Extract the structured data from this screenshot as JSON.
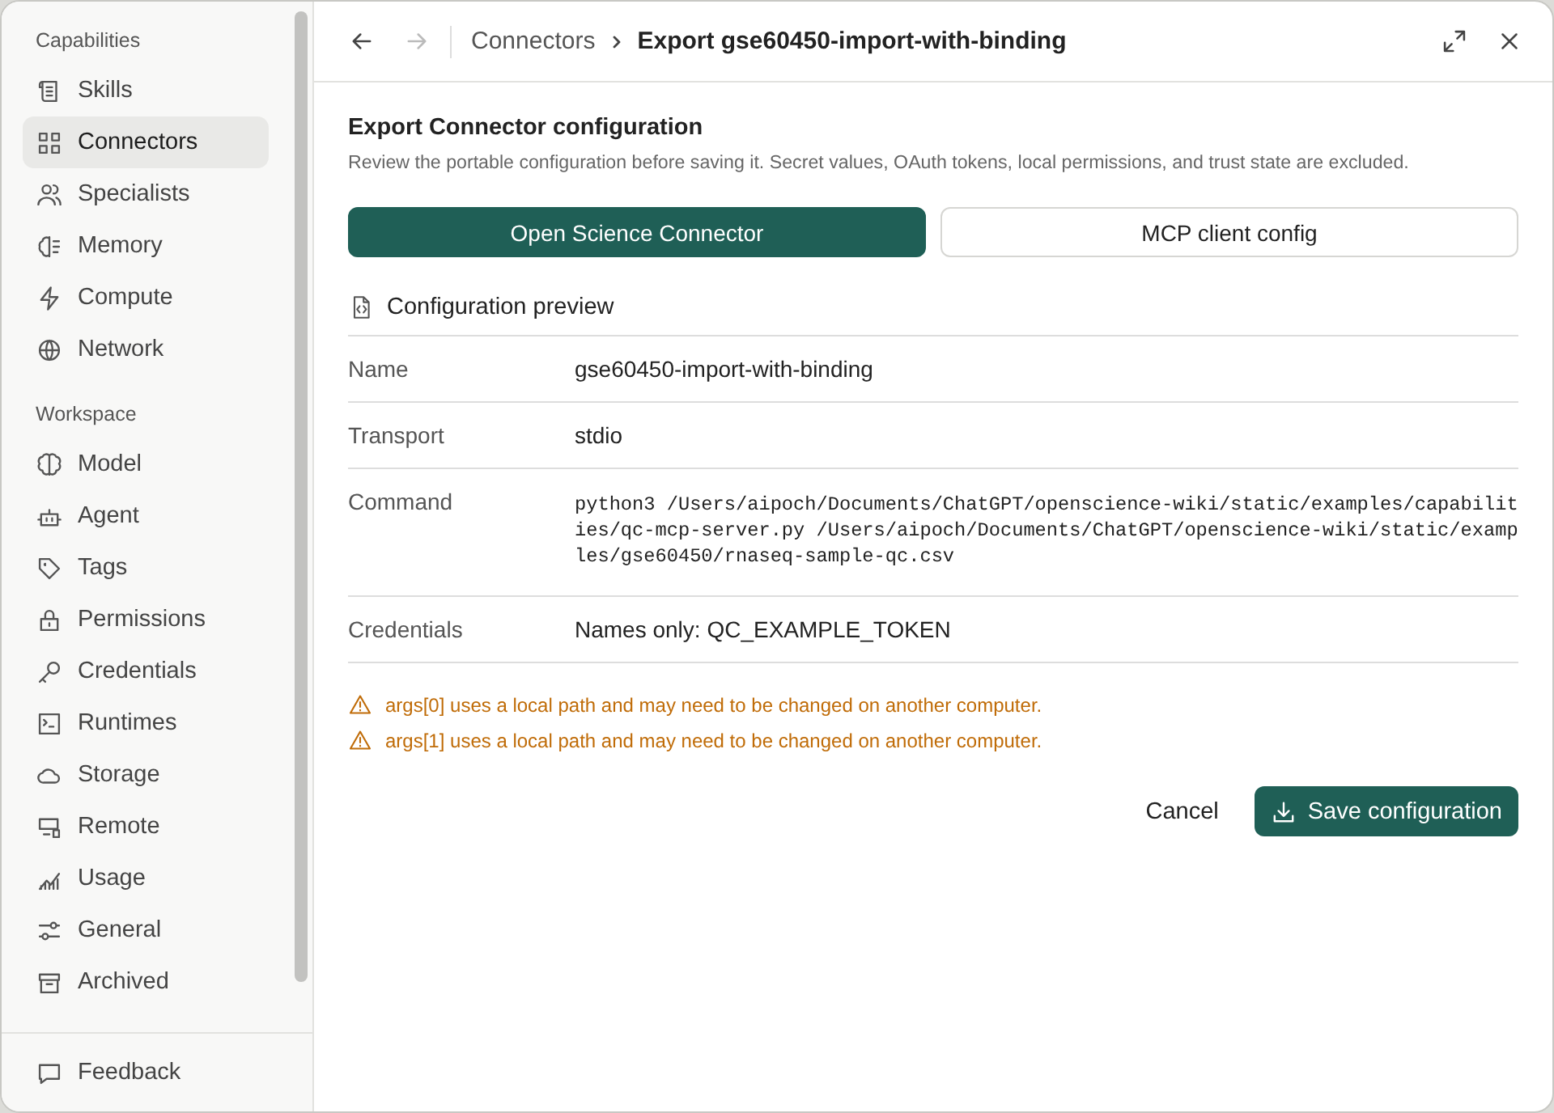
{
  "sidebar": {
    "sections": [
      {
        "label": "Capabilities",
        "items": [
          {
            "label": "Skills",
            "selected": false
          },
          {
            "label": "Connectors",
            "selected": true
          },
          {
            "label": "Specialists",
            "selected": false
          },
          {
            "label": "Memory",
            "selected": false
          },
          {
            "label": "Compute",
            "selected": false
          },
          {
            "label": "Network",
            "selected": false
          }
        ]
      },
      {
        "label": "Workspace",
        "items": [
          {
            "label": "Model",
            "selected": false
          },
          {
            "label": "Agent",
            "selected": false
          },
          {
            "label": "Tags",
            "selected": false
          },
          {
            "label": "Permissions",
            "selected": false
          },
          {
            "label": "Credentials",
            "selected": false
          },
          {
            "label": "Runtimes",
            "selected": false
          },
          {
            "label": "Storage",
            "selected": false
          },
          {
            "label": "Remote",
            "selected": false
          },
          {
            "label": "Usage",
            "selected": false
          },
          {
            "label": "General",
            "selected": false
          },
          {
            "label": "Archived",
            "selected": false
          }
        ]
      }
    ],
    "footer": "Feedback"
  },
  "header": {
    "back_disabled": false,
    "forward_disabled": true,
    "breadcrumb": [
      "Connectors",
      "Export gse60450-import-with-binding"
    ]
  },
  "dialog": {
    "title": "Export Connector configuration",
    "description": "Review the portable configuration before saving it. Secret values, OAuth tokens, local permissions, and trust state are excluded.",
    "tabs": [
      {
        "label": "Open Science Connector",
        "selected": true
      },
      {
        "label": "MCP client config",
        "selected": false
      }
    ],
    "preview_title": "Configuration preview",
    "rows": [
      {
        "label": "Name",
        "value": "gse60450-import-with-binding",
        "kind": "text"
      },
      {
        "label": "Transport",
        "value": "stdio",
        "kind": "text"
      },
      {
        "label": "Command",
        "value": "python3 /Users/aipoch/Documents/ChatGPT/openscience-wiki/static/examples/capabilities/qc-mcp-server.py /Users/aipoch/Documents/ChatGPT/openscience-wiki/static/examples/gse60450/rnaseq-sample-qc.csv",
        "kind": "code"
      },
      {
        "label": "Credentials",
        "value": "Names only: QC_EXAMPLE_TOKEN",
        "kind": "text"
      }
    ],
    "warnings": [
      "args[0] uses a local path and may need to be changed on another computer.",
      "args[1] uses a local path and may need to be changed on another computer."
    ],
    "cancel": "Cancel",
    "save": "Save configuration"
  }
}
